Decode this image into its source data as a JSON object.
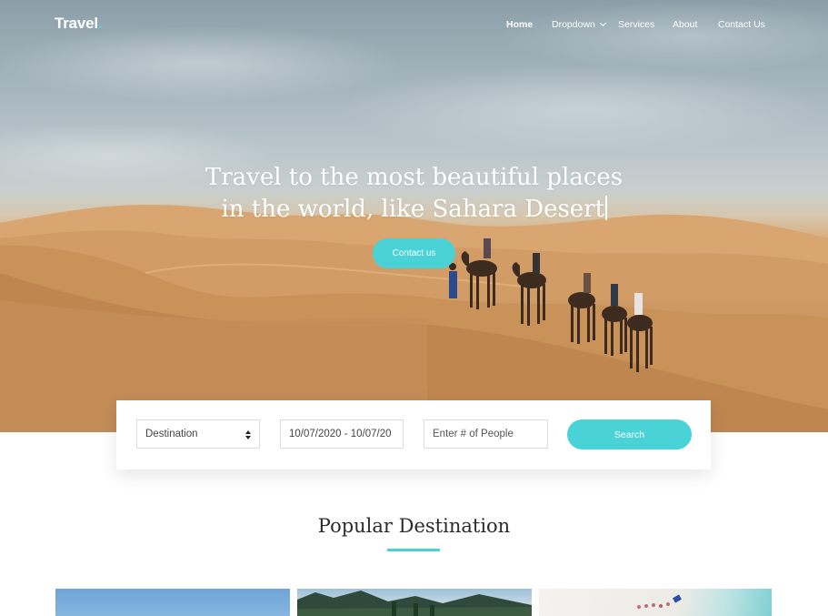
{
  "brand": {
    "name": "Travel",
    "dot": ".",
    "accent": "#4ad3d6"
  },
  "nav": {
    "items": [
      {
        "label": "Home",
        "active": true
      },
      {
        "label": "Dropdown",
        "has_dropdown": true
      },
      {
        "label": "Services"
      },
      {
        "label": "About"
      },
      {
        "label": "Contact Us"
      }
    ]
  },
  "hero": {
    "line1": "Travel to the most beautiful places",
    "line2": "in the world, like Sahara Desert",
    "cta": "Contact us"
  },
  "search": {
    "destination": "Destination",
    "dates": "10/07/2020 - 10/07/20",
    "people_placeholder": "Enter # of People",
    "button": "Search"
  },
  "popular": {
    "title": "Popular Destination",
    "cards": [
      {
        "name": "destination-card-1"
      },
      {
        "name": "destination-card-2"
      },
      {
        "name": "destination-card-3"
      }
    ]
  },
  "colors": {
    "accent": "#4ad3d6",
    "text_dark": "#2b2b2b",
    "white": "#ffffff"
  }
}
